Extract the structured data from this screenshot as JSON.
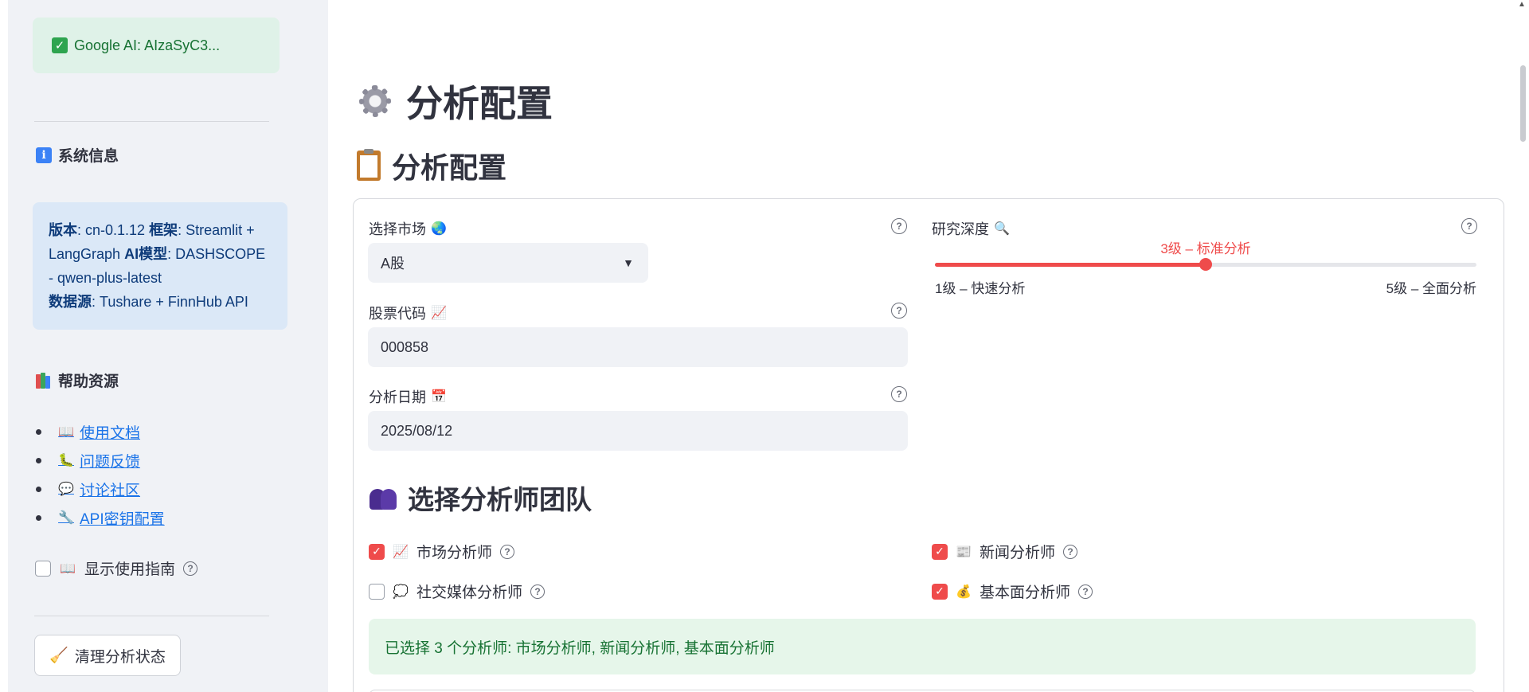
{
  "sidebar": {
    "api_status": "Google AI: AIzaSyC3...",
    "system_info_heading": "系统信息",
    "system_info": {
      "version_label": "版本",
      "version_value": ": cn-0.1.12 ",
      "framework_label": "框架",
      "framework_value": ": Streamlit + LangGraph ",
      "model_label": "AI模型",
      "model_value": ": DASHSCOPE - qwen-plus-latest",
      "source_label": "数据源",
      "source_value": ": Tushare + FinnHub API"
    },
    "help_heading": "帮助资源",
    "help_links": [
      {
        "label": "使用文档",
        "icon": "book-icon"
      },
      {
        "label": "问题反馈",
        "icon": "bug-icon"
      },
      {
        "label": "讨论社区",
        "icon": "speech-icon"
      },
      {
        "label": "API密钥配置",
        "icon": "wrench-icon"
      }
    ],
    "guide_checkbox_label": "显示使用指南",
    "clear_button_label": "清理分析状态"
  },
  "main": {
    "page_title": "分析配置",
    "section_title": "分析配置",
    "market_label": "选择市场",
    "market_value": "A股",
    "stock_label": "股票代码",
    "stock_value": "000858",
    "date_label": "分析日期",
    "date_value": "2025/08/12",
    "depth_label": "研究深度",
    "depth": {
      "value_label": "3级 – 标准分析",
      "min_label": "1级 – 快速分析",
      "max_label": "5级 – 全面分析",
      "level": 3,
      "min": 1,
      "max": 5
    },
    "team_title": "选择分析师团队",
    "analysts": [
      {
        "label": "市场分析师",
        "checked": true
      },
      {
        "label": "新闻分析师",
        "checked": true
      },
      {
        "label": "社交媒体分析师",
        "checked": false
      },
      {
        "label": "基本面分析师",
        "checked": true
      }
    ],
    "selected_summary": "已选择 3 个分析师: 市场分析师, 新闻分析师, 基本面分析师"
  },
  "colors": {
    "accent": "#ef4b4b",
    "success_bg": "#e6f6ea",
    "info_bg": "#dbe8f7"
  }
}
